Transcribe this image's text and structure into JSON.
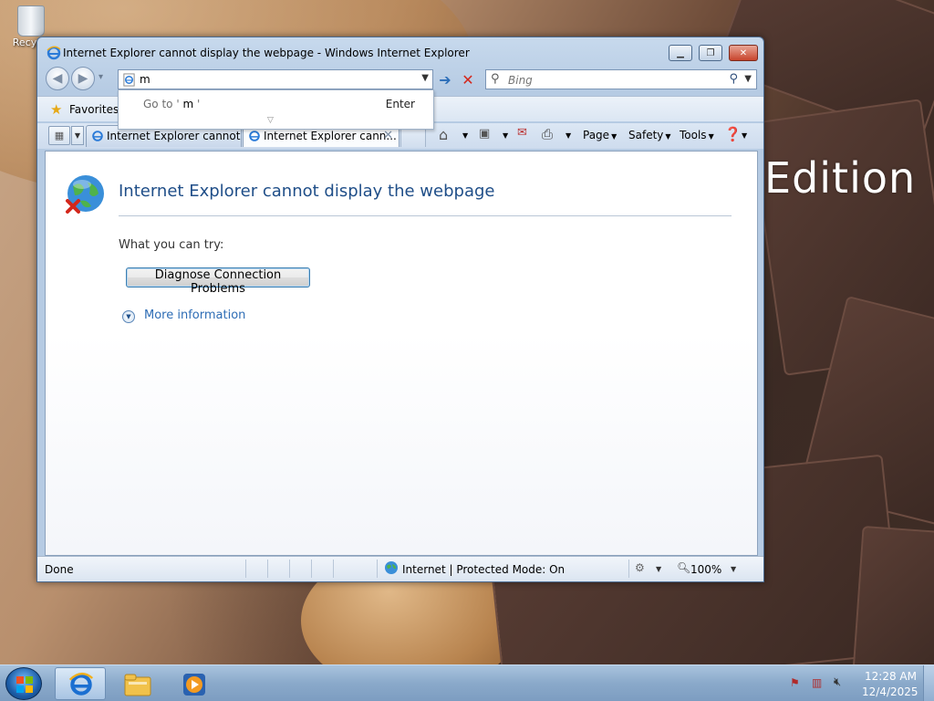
{
  "desktop": {
    "recycle_bin_label": "Recyc",
    "wallpaper_text": "Edition"
  },
  "window": {
    "title": "Internet Explorer cannot display the webpage - Windows Internet Explorer"
  },
  "address": {
    "value": "m",
    "autocomplete_goto": "Go to '",
    "autocomplete_term": "m",
    "autocomplete_close": "'",
    "autocomplete_enter": "Enter"
  },
  "search": {
    "placeholder": "Bing"
  },
  "favorites": {
    "label": "Favorites"
  },
  "tabs": [
    {
      "label": "Internet Explorer cannot ..."
    },
    {
      "label": "Internet Explorer cann..."
    }
  ],
  "command_bar": {
    "page": "Page",
    "safety": "Safety",
    "tools": "Tools"
  },
  "page": {
    "title": "Internet Explorer cannot display the webpage",
    "try_label": "What you can try:",
    "diagnose_button": "Diagnose Connection Problems",
    "more_info": "More information"
  },
  "status": {
    "text": "Done",
    "zone": "Internet | Protected Mode: On",
    "zoom": "100%"
  },
  "taskbar": {
    "time": "12:28 AM",
    "date": "12/4/2025"
  },
  "colors": {
    "title_blue": "#1f4e88",
    "link_blue": "#2e6db5",
    "close_red": "#c8442c"
  }
}
